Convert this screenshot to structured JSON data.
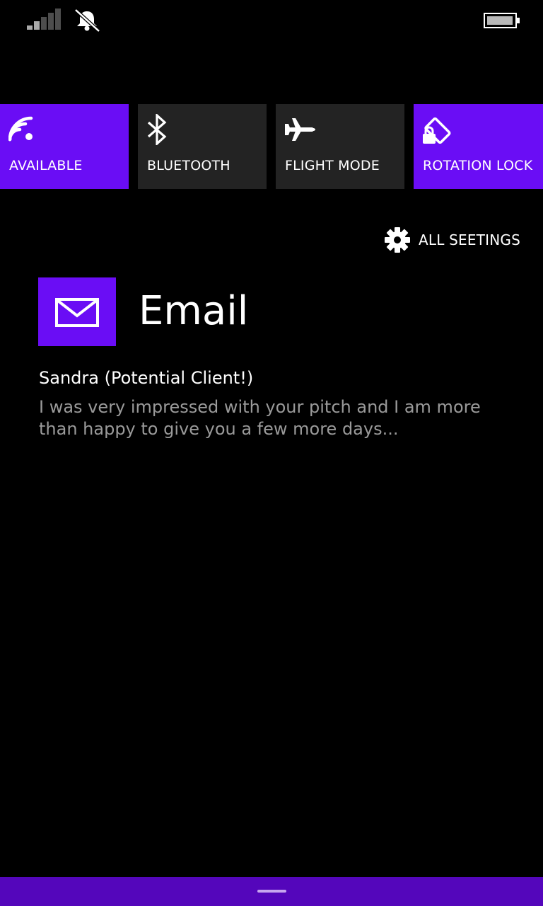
{
  "colors": {
    "accent": "#6a0df5",
    "tile_inactive": "#232323",
    "bottom_bar": "#5406bb",
    "handle": "#c7a6ef",
    "signal_active": "#a9a9a9",
    "signal_inactive": "#4d4d4d",
    "preview_text": "#9a9a9a"
  },
  "status_bar": {
    "signal_icon": "signal-strength-icon",
    "bell_icon": "bell-muted-icon",
    "battery_icon": "battery-icon"
  },
  "quick_actions": [
    {
      "label": "AVAILABLE",
      "icon": "wifi-icon",
      "active": true
    },
    {
      "label": "BLUETOOTH",
      "icon": "bluetooth-icon",
      "active": false
    },
    {
      "label": "FLIGHT MODE",
      "icon": "airplane-icon",
      "active": false
    },
    {
      "label": "ROTATION LOCK",
      "icon": "rotation-lock-icon",
      "active": true
    }
  ],
  "all_settings": {
    "label": "ALL SEETINGS",
    "icon": "gear-icon"
  },
  "notification": {
    "app_name": "Email",
    "icon": "envelope-icon",
    "sender": "Sandra (Potential Client!)",
    "preview": "I was very impressed with your pitch and I am more than happy to give you a few more days..."
  },
  "bottom_bar": {
    "handle_icon": "drag-handle-icon"
  }
}
